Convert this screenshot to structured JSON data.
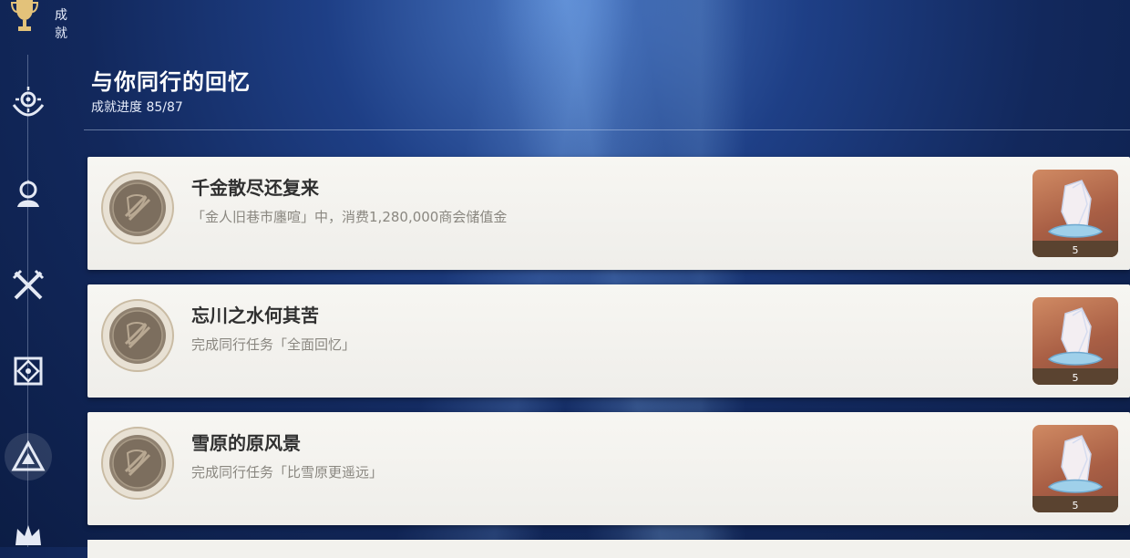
{
  "header": {
    "section_label": "成就"
  },
  "category": {
    "title": "与你同行的回忆",
    "progress": "成就进度 85/87"
  },
  "achievements": [
    {
      "name": "千金散尽还复来",
      "description": "「金人旧巷市廛喧」中，消费1,280,000商会储值金",
      "reward_count": "5"
    },
    {
      "name": "忘川之水何其苦",
      "description": "完成同行任务「全面回忆」",
      "reward_count": "5"
    },
    {
      "name": "雪原的原风景",
      "description": "完成同行任务「比雪原更遥远」",
      "reward_count": "5"
    }
  ],
  "icons": [
    "trophy-icon",
    "gear-hand-icon",
    "bust-icon",
    "crossed-swords-icon",
    "diamond-emblem-icon",
    "triangle-emblem-icon",
    "crown-icon"
  ],
  "colors": {
    "background": "#12285c",
    "card": "#f3f2ee",
    "title_text": "#303030",
    "desc_text": "#8a8780",
    "reward_bg": "#b8694c"
  }
}
